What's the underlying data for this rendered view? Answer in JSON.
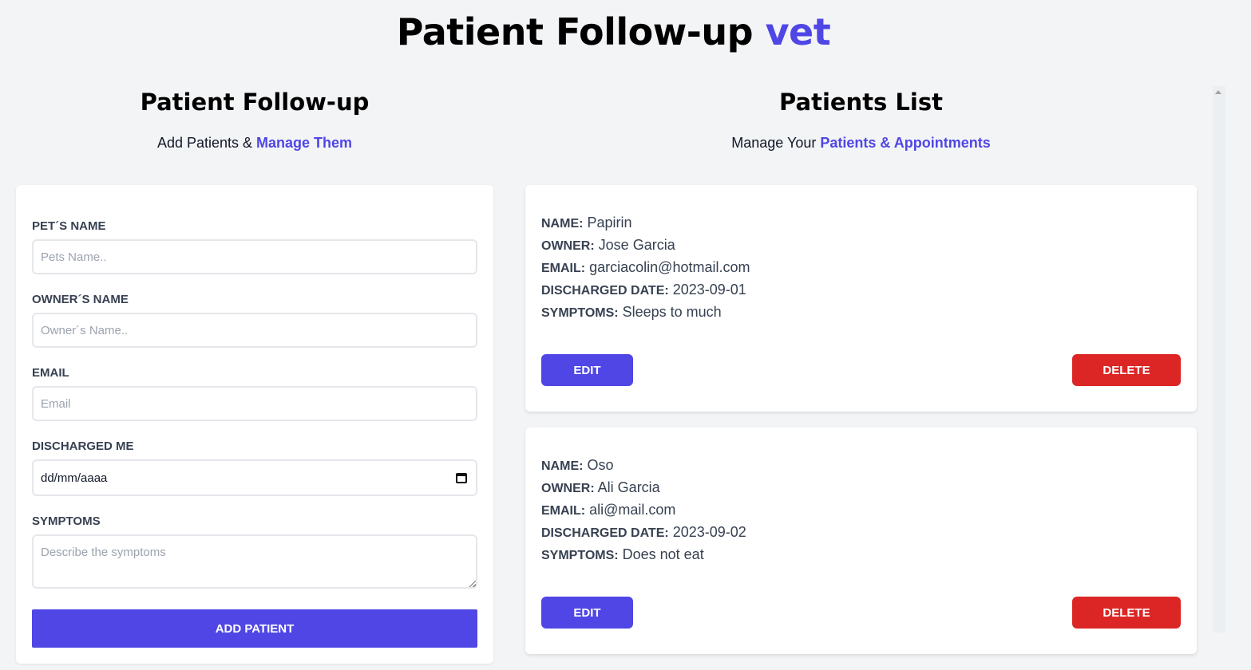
{
  "header": {
    "title_main": "Patient Follow-up",
    "title_accent": "vet"
  },
  "form_section": {
    "heading": "Patient Follow-up",
    "subtitle_plain": "Add Patients &",
    "subtitle_accent": "Manage Them"
  },
  "form": {
    "pet_name": {
      "label": "PET´S NAME",
      "placeholder": "Pets Name..",
      "value": ""
    },
    "owner_name": {
      "label": "OWNER´S NAME",
      "placeholder": "Owner´s Name..",
      "value": ""
    },
    "email": {
      "label": "EMAIL",
      "placeholder": "Email",
      "value": ""
    },
    "discharged": {
      "label": "DISCHARGED ME",
      "value": "dd/mm/aaaa",
      "icon": "calendar-icon"
    },
    "symptoms": {
      "label": "SYMPTOMS",
      "placeholder": "Describe the symptoms",
      "value": ""
    },
    "submit_label": "ADD PATIENT"
  },
  "list_section": {
    "heading": "Patients List",
    "subtitle_plain": "Manage Your",
    "subtitle_accent": "Patients & Appointments"
  },
  "field_labels": {
    "name": "NAME:",
    "owner": "OWNER:",
    "email": "EMAIL:",
    "discharged": "DISCHARGED DATE:",
    "symptoms": "SYMPTOMS:"
  },
  "patients": [
    {
      "name": "Papirin",
      "owner": "Jose Garcia",
      "email": "garciacolin@hotmail.com",
      "discharged": "2023-09-01",
      "symptoms": "Sleeps to much",
      "edit_label": "EDIT",
      "delete_label": "DELETE"
    },
    {
      "name": "Oso",
      "owner": "Ali Garcia",
      "email": "ali@mail.com",
      "discharged": "2023-09-02",
      "symptoms": "Does not eat",
      "edit_label": "EDIT",
      "delete_label": "DELETE"
    }
  ],
  "colors": {
    "accent": "#4f46e5",
    "danger": "#dc2626",
    "background": "#f3f4f6"
  }
}
